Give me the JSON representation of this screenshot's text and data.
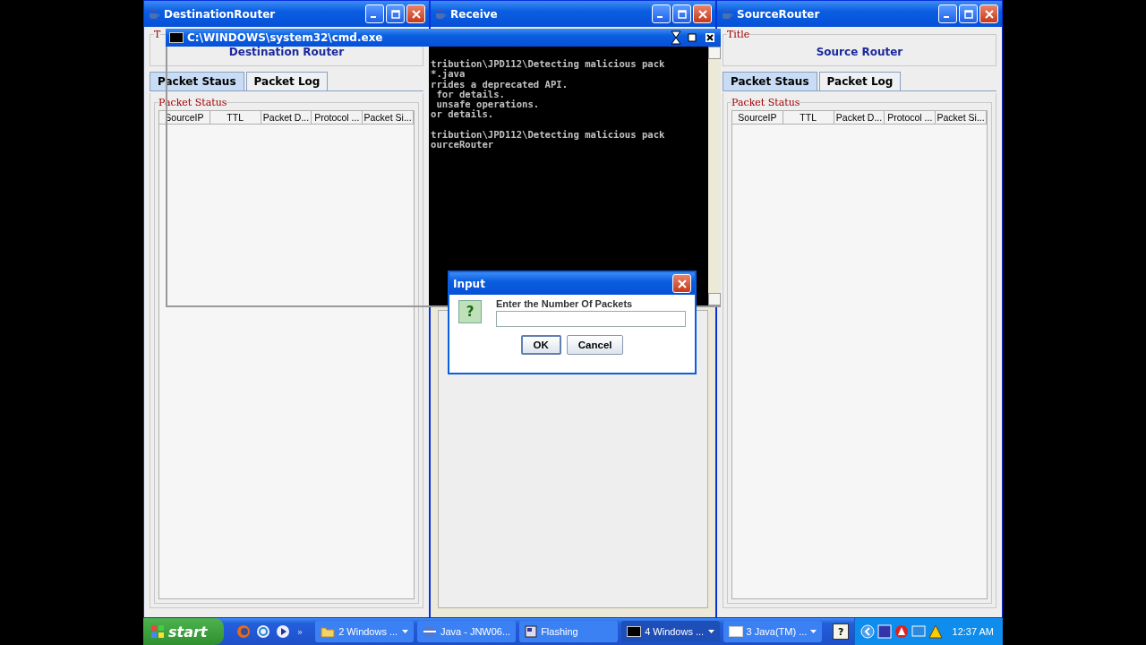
{
  "routers": [
    {
      "title": "DestinationRouter",
      "title_legend": "T",
      "heading": "Destination Router",
      "tabs": [
        {
          "label": "Packet Staus",
          "selected": true
        },
        {
          "label": "Packet Log",
          "selected": false
        }
      ],
      "status_legend": "Packet Status",
      "columns": [
        "SourceIP",
        "TTL",
        "Packet D...",
        "Protocol ...",
        "Packet Si..."
      ]
    },
    {
      "title": "SourceRouter",
      "title_legend": "Title",
      "heading": "Source Router",
      "tabs": [
        {
          "label": "Packet Staus",
          "selected": true
        },
        {
          "label": "Packet Log",
          "selected": false
        }
      ],
      "status_legend": "Packet Status",
      "columns": [
        "SourceIP",
        "TTL",
        "Packet D...",
        "Protocol ...",
        "Packet Si..."
      ]
    }
  ],
  "receive_window": {
    "title": "Receive"
  },
  "console": {
    "title": "C:\\WINDOWS\\system32\\cmd.exe",
    "blocks": [
      [
        "tribution\\JPD112\\Detecting malicious pack",
        "*.java",
        "rrides a deprecated API.",
        " for details.",
        " unsafe operations.",
        "or details."
      ],
      [
        "tribution\\JPD112\\Detecting malicious pack",
        "ourceRouter"
      ]
    ]
  },
  "dialog": {
    "title": "Input",
    "icon": "?",
    "message": "Enter the Number Of Packets",
    "buttons": [
      {
        "label": "OK",
        "focused": true
      },
      {
        "label": "Cancel",
        "focused": false
      }
    ]
  },
  "taskbar": {
    "start": "start",
    "more": "»",
    "tasks": [
      {
        "label": "2 Windows ...",
        "kind": "folder",
        "dropdown": true,
        "active": false
      },
      {
        "label": "Java - JNW06...",
        "kind": "java",
        "dropdown": false,
        "active": false
      },
      {
        "label": "Flashing",
        "kind": "app",
        "dropdown": false,
        "active": false
      },
      {
        "label": "4 Windows ...",
        "kind": "console",
        "dropdown": true,
        "active": true
      },
      {
        "label": "3 Java(TM) ...",
        "kind": "window",
        "dropdown": true,
        "active": false
      }
    ],
    "help": "?",
    "clock": "12:37 AM"
  }
}
